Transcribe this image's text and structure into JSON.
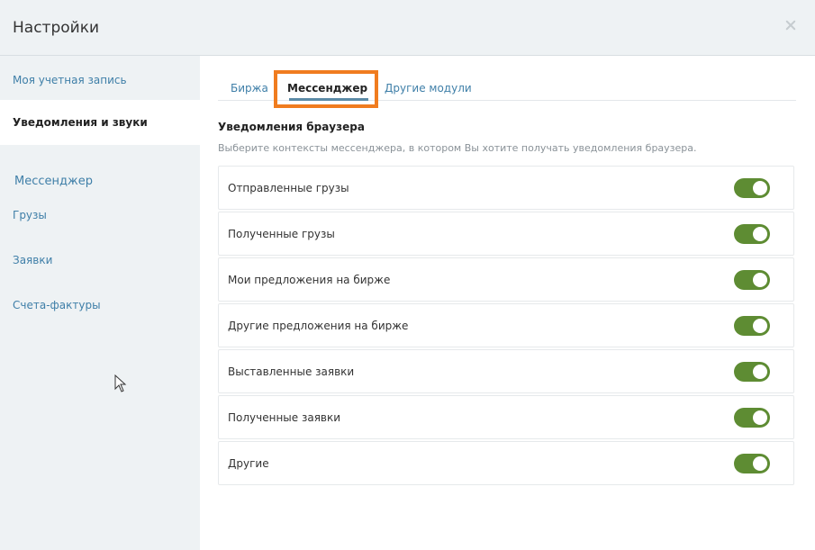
{
  "dialog": {
    "title": "Настройки",
    "close_icon": "close-icon"
  },
  "sidebar": {
    "items": [
      {
        "label": "Моя учетная запись",
        "active": false
      },
      {
        "label": "Уведомления и звуки",
        "active": true
      },
      {
        "label": "Мессенджер",
        "active": false
      },
      {
        "label": "Грузы",
        "active": false
      },
      {
        "label": "Заявки",
        "active": false
      },
      {
        "label": "Счета-фактуры",
        "active": false
      }
    ]
  },
  "tabs": [
    {
      "label": "Биржа",
      "active": false
    },
    {
      "label": "Мессенджер",
      "active": true
    },
    {
      "label": "Другие модули",
      "active": false
    }
  ],
  "section": {
    "title": "Уведомления браузера",
    "description": "Выберите контексты мессенджера, в котором Вы хотите получать уведомления браузера."
  },
  "settings": [
    {
      "label": "Отправленные грузы",
      "enabled": true
    },
    {
      "label": "Полученные грузы",
      "enabled": true
    },
    {
      "label": "Мои предложения на бирже",
      "enabled": true
    },
    {
      "label": "Другие предложения на бирже",
      "enabled": true
    },
    {
      "label": "Выставленные заявки",
      "enabled": true
    },
    {
      "label": "Полученные заявки",
      "enabled": true
    },
    {
      "label": "Другие",
      "enabled": true
    }
  ],
  "colors": {
    "toggle_on": "#5e8c33",
    "link": "#3f7fa8",
    "highlight": "#f07c1f",
    "sidebar_bg": "#eef2f4"
  }
}
